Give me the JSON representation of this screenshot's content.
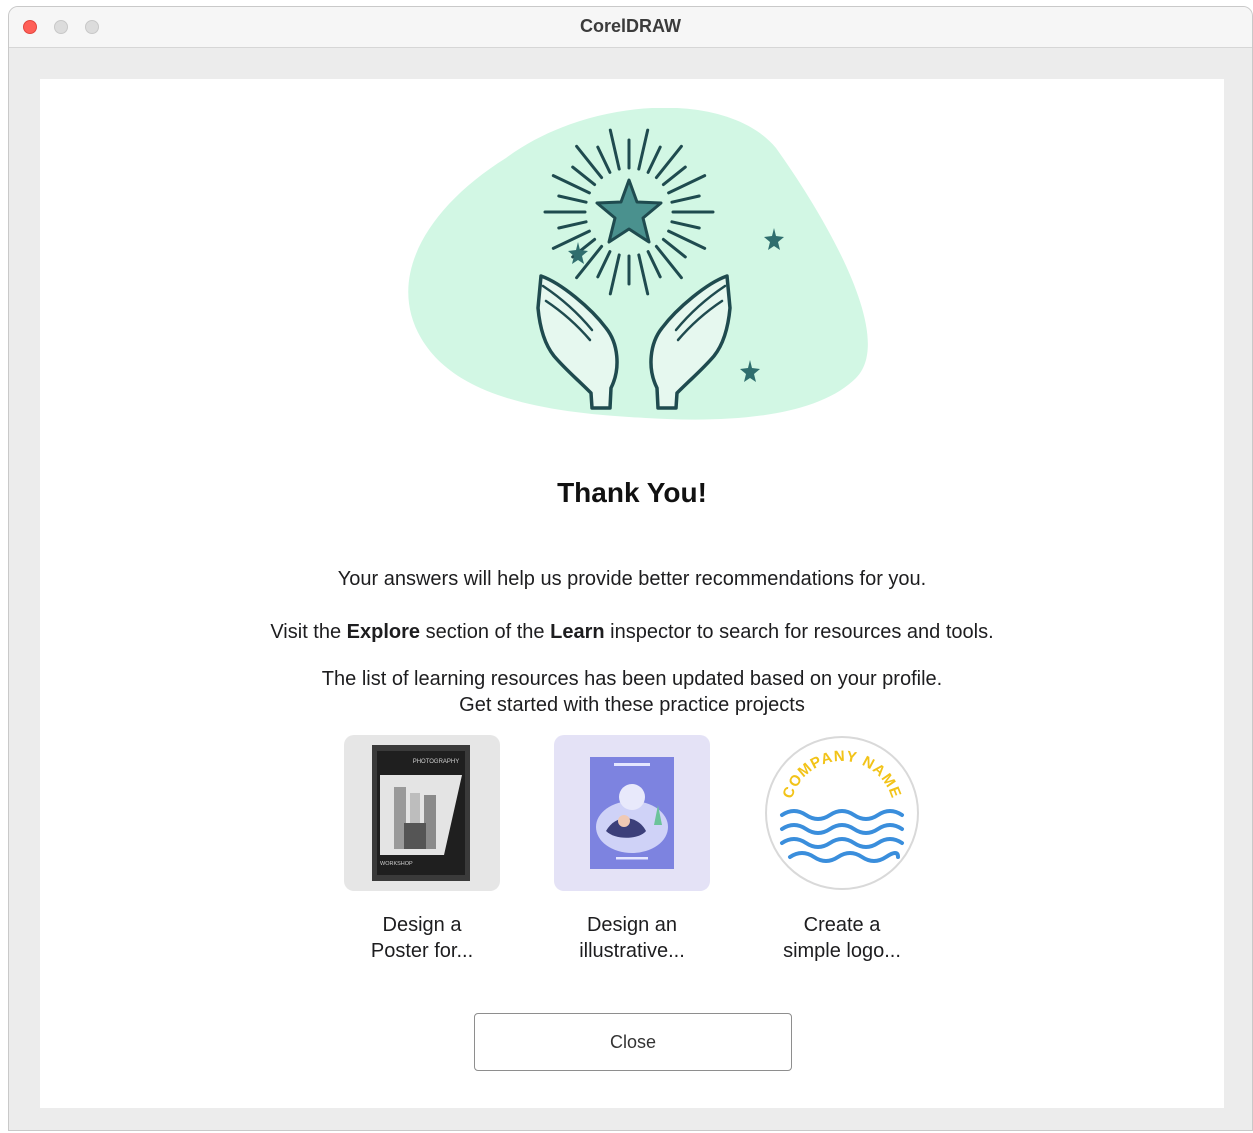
{
  "window": {
    "title": "CorelDRAW"
  },
  "dialog": {
    "heading": "Thank You!",
    "line1": "Your answers will help us provide better recommendations for you.",
    "line2_prefix": "Visit the ",
    "line2_explore": "Explore",
    "line2_middle": " section of the ",
    "line2_learn": "Learn",
    "line2_suffix": " inspector to search for resources and tools.",
    "line3": "The list of learning resources has been updated based on your profile.",
    "line4": "Get started with these practice projects"
  },
  "projects": [
    {
      "label": "Design a\nPoster for...",
      "thumb_text_top": "PHOTOGRAPHY",
      "thumb_text_bottom": "WORKSHOP"
    },
    {
      "label": "Design an\nillustrative..."
    },
    {
      "label": "Create a\nsimple logo...",
      "logo_text": "COMPANY NAME"
    }
  ],
  "close_button": {
    "label": "Close"
  },
  "colors": {
    "blob": "#d2f7e4",
    "teal": "#4a918e",
    "dark_teal": "#1f4b4f",
    "close_red": "#ff5f57",
    "logo_yellow": "#f2c318",
    "logo_blue": "#3a8edc"
  }
}
